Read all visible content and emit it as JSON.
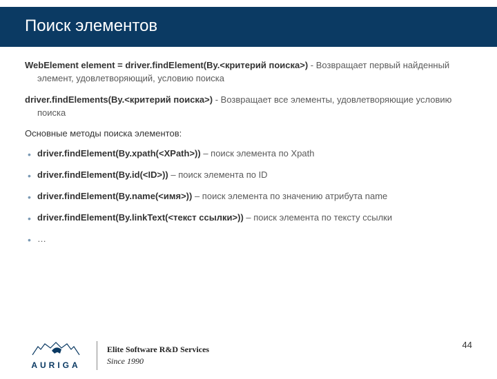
{
  "title": "Поиск элементов",
  "para1": {
    "code": "WebElement element = driver.findElement(By.<критерий поиска>)",
    "desc": " - Возвращает первый найденный элемент, удовлетворяющий, условию поиска"
  },
  "para2": {
    "code": "driver.findElements(By.<критерий поиска>)",
    "desc": " - Возвращает все элементы, удовлетворяющие условию поиска"
  },
  "methods_title": "Основные методы поиска элементов:",
  "methods": [
    {
      "code": "driver.findElement(By.xpath(<XPath>))",
      "desc": " – поиск элемента по Xpath"
    },
    {
      "code": "driver.findElement(By.id(<ID>))",
      "desc": " – поиск элемента по ID"
    },
    {
      "code": "driver.findElement(By.name(<имя>))",
      "desc": " – поиск элемента по значению атрибута name"
    },
    {
      "code": "driver.findElement(By.linkText(<текст ссылки>))",
      "desc": " – поиск элемента по тексту ссылки"
    },
    {
      "code": "…",
      "desc": ""
    }
  ],
  "footer": {
    "brand_word": "AURIGA",
    "tagline1": "Elite Software R&D Services",
    "tagline2": "Since 1990"
  },
  "page_number": "44"
}
